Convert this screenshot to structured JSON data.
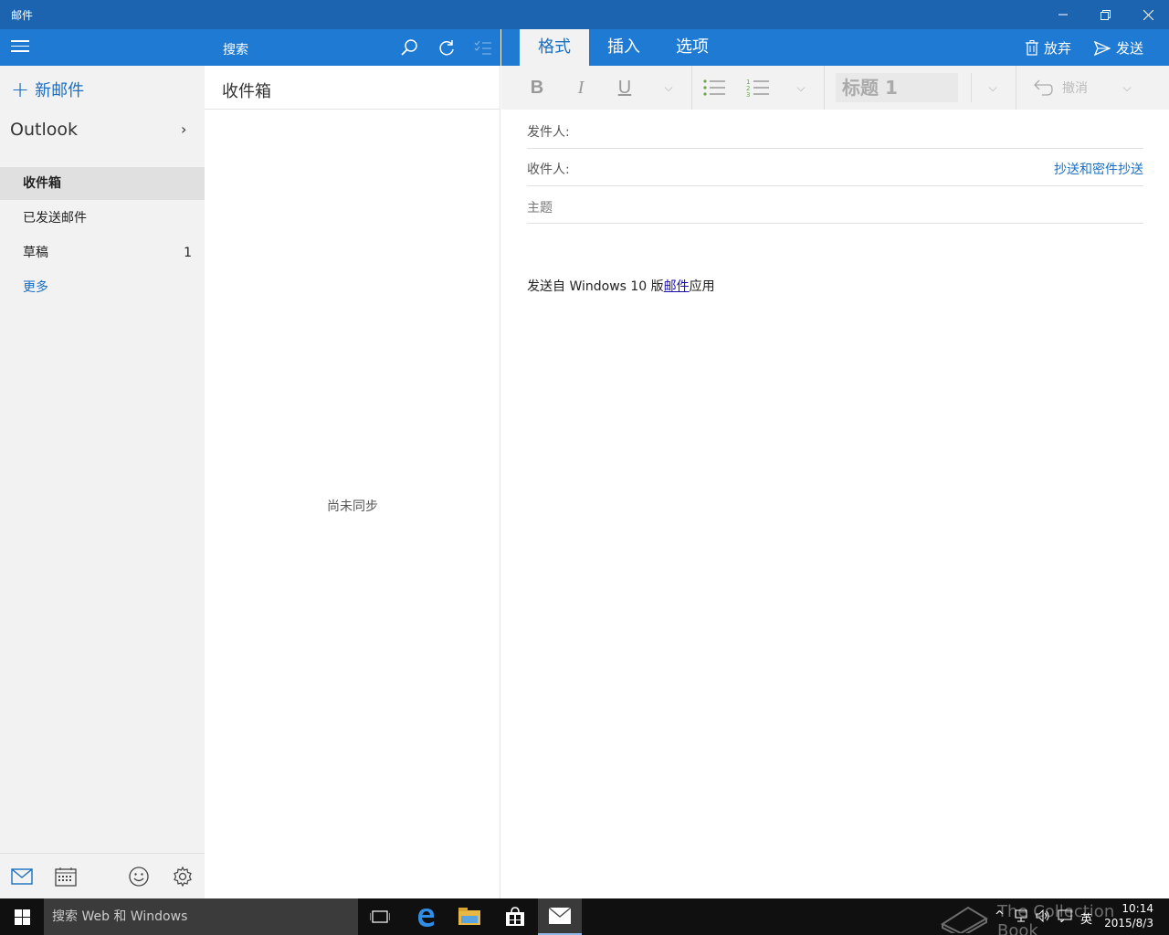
{
  "window": {
    "title": "邮件"
  },
  "nav": {
    "new_mail": "新邮件",
    "account": "Outlook",
    "folders": [
      {
        "label": "收件箱",
        "count": ""
      },
      {
        "label": "已发送邮件",
        "count": ""
      },
      {
        "label": "草稿",
        "count": "1"
      },
      {
        "label": "更多",
        "count": ""
      }
    ]
  },
  "list": {
    "search_label": "搜索",
    "header": "收件箱",
    "empty_text": "尚未同步"
  },
  "compose": {
    "tabs": [
      "格式",
      "插入",
      "选项"
    ],
    "discard": "放弃",
    "send": "发送",
    "style_value": "标题 1",
    "undo": "撤消",
    "from_label": "发件人:",
    "to_label": "收件人:",
    "cc_link": "抄送和密件抄送",
    "subject_placeholder": "主题",
    "signature_prefix": "发送自 Windows 10 版",
    "signature_link": "邮件",
    "signature_suffix": "应用"
  },
  "taskbar": {
    "search_placeholder": "搜索 Web 和 Windows",
    "ime": "英",
    "time": "10:14",
    "date": "2015/8/3",
    "watermark": "The Collection Book"
  },
  "colors": {
    "accent": "#1f7ad3",
    "titlebar": "#1d64b0",
    "link": "#1a6fc2"
  }
}
